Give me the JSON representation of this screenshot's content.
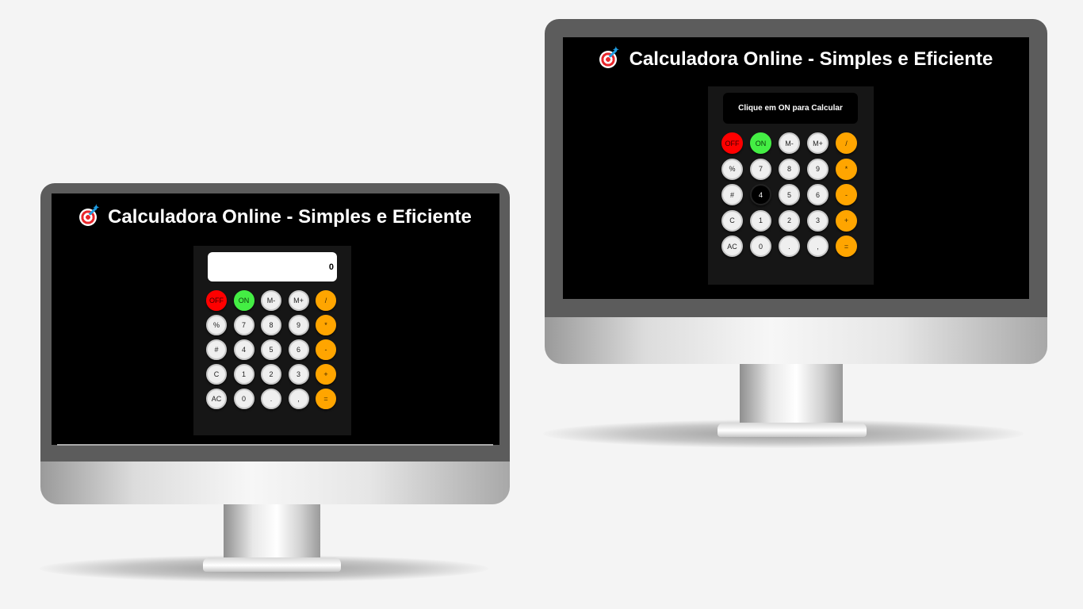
{
  "left_monitor": {
    "title": "Calculadora Online - Simples e Eficiente",
    "display_value": "0",
    "keys": [
      "OFF",
      "ON",
      "M-",
      "M+",
      "/",
      "%",
      "7",
      "8",
      "9",
      "*",
      "#",
      "4",
      "5",
      "6",
      "-",
      "C",
      "1",
      "2",
      "3",
      "+",
      "AC",
      "0",
      ".",
      ",",
      "="
    ]
  },
  "right_monitor": {
    "title": "Calculadora Online - Simples e Eficiente",
    "display_value": "Clique em ON para Calcular",
    "keys": [
      "OFF",
      "ON",
      "M-",
      "M+",
      "/",
      "%",
      "7",
      "8",
      "9",
      "*",
      "#",
      "4",
      "5",
      "6",
      "-",
      "C",
      "1",
      "2",
      "3",
      "+",
      "AC",
      "0",
      ".",
      ",",
      "="
    ],
    "active_key": "4"
  },
  "colors": {
    "off_key": "#ff0000",
    "on_key": "#44ee44",
    "operator_key": "#ffa500",
    "number_key": "#efefef",
    "screen": "#000000",
    "calculator_body": "#161616",
    "page_background": "#f4f4f4"
  },
  "icons": {
    "title_icon": "dart-target-icon"
  }
}
